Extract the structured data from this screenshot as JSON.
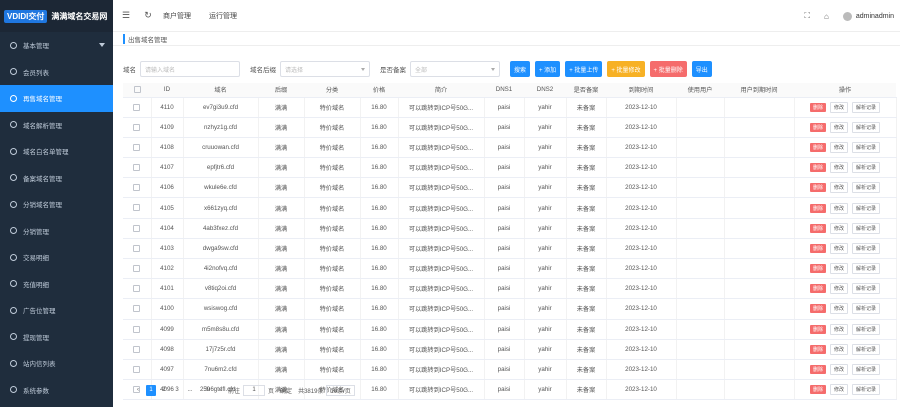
{
  "brand": {
    "logo": "VDIDI交付",
    "name": "满满域名交易网"
  },
  "sidebar": {
    "items": [
      {
        "label": "基本管理",
        "has_caret": true
      },
      {
        "label": "会员列表"
      },
      {
        "label": "再售域名管理",
        "active": true
      },
      {
        "label": "域名解析管理"
      },
      {
        "label": "域名白名单管理"
      },
      {
        "label": "备案域名管理"
      },
      {
        "label": "分销域名管理"
      },
      {
        "label": "分销管理"
      },
      {
        "label": "交易明细"
      },
      {
        "label": "充值明细"
      },
      {
        "label": "广告位管理"
      },
      {
        "label": "提现管理"
      },
      {
        "label": "站内信列表"
      },
      {
        "label": "系统参数"
      }
    ]
  },
  "navbar": {
    "links": [
      "商户管理",
      "运行管理"
    ],
    "user": "adminadmin"
  },
  "tab": "出售域名管理",
  "filters": {
    "domain_label": "域名",
    "domain_placeholder": "请输入域名",
    "suffix_label": "域名后缀",
    "suffix_placeholder": "请选择",
    "filing_label": "是否备案",
    "filing_placeholder": "全部"
  },
  "buttons": [
    {
      "label": "搜索",
      "color": "#1e90ff",
      "icon": "search-icon"
    },
    {
      "label": "+ 添加",
      "color": "#1e90ff",
      "icon": "plus-icon"
    },
    {
      "label": "+ 批量上传",
      "color": "#1e90ff",
      "icon": "upload-icon"
    },
    {
      "label": "+ 批量修改",
      "color": "#f7b125",
      "icon": "edit-icon"
    },
    {
      "label": "+ 批量删除",
      "color": "#f56c6c",
      "icon": "delete-icon"
    },
    {
      "label": "导出",
      "color": "#1e90ff",
      "icon": "export-icon"
    }
  ],
  "table": {
    "headers": [
      "",
      "ID",
      "域名",
      "后缀",
      "分类",
      "价格",
      "简介",
      "DNS1",
      "DNS2",
      "是否备案",
      "到期时间",
      "使用用户",
      "用户到期时间",
      "操作"
    ],
    "rows": [
      {
        "id": "4110",
        "domain": "ev7gi3u9.cfd",
        "suffix": "满满",
        "category": "特价域名",
        "price": "16.80",
        "intro": "可以跳转到ICP号50G...",
        "dns1": "paisi",
        "dns2": "yahir",
        "filing": "未备案",
        "expire": "2023-12-10"
      },
      {
        "id": "4109",
        "domain": "nzhyz1g.cfd",
        "suffix": "满满",
        "category": "特价域名",
        "price": "16.80",
        "intro": "可以跳转到ICP号50G...",
        "dns1": "paisi",
        "dns2": "yahir",
        "filing": "未备案",
        "expire": "2023-12-10"
      },
      {
        "id": "4108",
        "domain": "cruuowan.cfd",
        "suffix": "满满",
        "category": "特价域名",
        "price": "16.80",
        "intro": "可以跳转到ICP号50G...",
        "dns1": "paisi",
        "dns2": "yahir",
        "filing": "未备案",
        "expire": "2023-12-10"
      },
      {
        "id": "4107",
        "domain": "epfjtr6.cfd",
        "suffix": "满满",
        "category": "特价域名",
        "price": "16.80",
        "intro": "可以跳转到ICP号50G...",
        "dns1": "paisi",
        "dns2": "yahir",
        "filing": "未备案",
        "expire": "2023-12-10"
      },
      {
        "id": "4106",
        "domain": "wkule6e.cfd",
        "suffix": "满满",
        "category": "特价域名",
        "price": "16.80",
        "intro": "可以跳转到ICP号50G...",
        "dns1": "paisi",
        "dns2": "yahir",
        "filing": "未备案",
        "expire": "2023-12-10"
      },
      {
        "id": "4105",
        "domain": "x661zyq.cfd",
        "suffix": "满满",
        "category": "特价域名",
        "price": "16.80",
        "intro": "可以跳转到ICP号50G...",
        "dns1": "paisi",
        "dns2": "yahir",
        "filing": "未备案",
        "expire": "2023-12-10"
      },
      {
        "id": "4104",
        "domain": "4ab3fxez.cfd",
        "suffix": "满满",
        "category": "特价域名",
        "price": "16.80",
        "intro": "可以跳转到ICP号50G...",
        "dns1": "paisi",
        "dns2": "yahir",
        "filing": "未备案",
        "expire": "2023-12-10"
      },
      {
        "id": "4103",
        "domain": "dwga9sw.cfd",
        "suffix": "满满",
        "category": "特价域名",
        "price": "16.80",
        "intro": "可以跳转到ICP号50G...",
        "dns1": "paisi",
        "dns2": "yahir",
        "filing": "未备案",
        "expire": "2023-12-10"
      },
      {
        "id": "4102",
        "domain": "4i2nofvq.cfd",
        "suffix": "满满",
        "category": "特价域名",
        "price": "16.80",
        "intro": "可以跳转到ICP号50G...",
        "dns1": "paisi",
        "dns2": "yahir",
        "filing": "未备案",
        "expire": "2023-12-10"
      },
      {
        "id": "4101",
        "domain": "v8tiq2oi.cfd",
        "suffix": "满满",
        "category": "特价域名",
        "price": "16.80",
        "intro": "可以跳转到ICP号50G...",
        "dns1": "paisi",
        "dns2": "yahir",
        "filing": "未备案",
        "expire": "2023-12-10"
      },
      {
        "id": "4100",
        "domain": "wsiswog.cfd",
        "suffix": "满满",
        "category": "特价域名",
        "price": "16.80",
        "intro": "可以跳转到ICP号50G...",
        "dns1": "paisi",
        "dns2": "yahir",
        "filing": "未备案",
        "expire": "2023-12-10"
      },
      {
        "id": "4099",
        "domain": "m5m8s8u.cfd",
        "suffix": "满满",
        "category": "特价域名",
        "price": "16.80",
        "intro": "可以跳转到ICP号50G...",
        "dns1": "paisi",
        "dns2": "yahir",
        "filing": "未备案",
        "expire": "2023-12-10"
      },
      {
        "id": "4098",
        "domain": "17j7z5r.cfd",
        "suffix": "满满",
        "category": "特价域名",
        "price": "16.80",
        "intro": "可以跳转到ICP号50G...",
        "dns1": "paisi",
        "dns2": "yahir",
        "filing": "未备案",
        "expire": "2023-12-10"
      },
      {
        "id": "4097",
        "domain": "7nu6m2.cfd",
        "suffix": "满满",
        "category": "特价域名",
        "price": "16.80",
        "intro": "可以跳转到ICP号50G...",
        "dns1": "paisi",
        "dns2": "yahir",
        "filing": "未备案",
        "expire": "2023-12-10"
      },
      {
        "id": "4096",
        "domain": "lu6gtdfl.cfd",
        "suffix": "满满",
        "category": "特价域名",
        "price": "16.80",
        "intro": "可以跳转到ICP号50G...",
        "dns1": "paisi",
        "dns2": "yahir",
        "filing": "未备案",
        "expire": "2023-12-10"
      }
    ],
    "ops": {
      "delete": "删除",
      "edit": "修改",
      "log": "解析记录"
    }
  },
  "pager": {
    "pages": [
      "1",
      "2",
      "3"
    ],
    "ellipsis": "...",
    "last": "259",
    "goto_label": "前往",
    "goto_value": "1",
    "page_suffix": "页",
    "confirm": "确定",
    "total": "共3819条",
    "size": "10条/页"
  }
}
